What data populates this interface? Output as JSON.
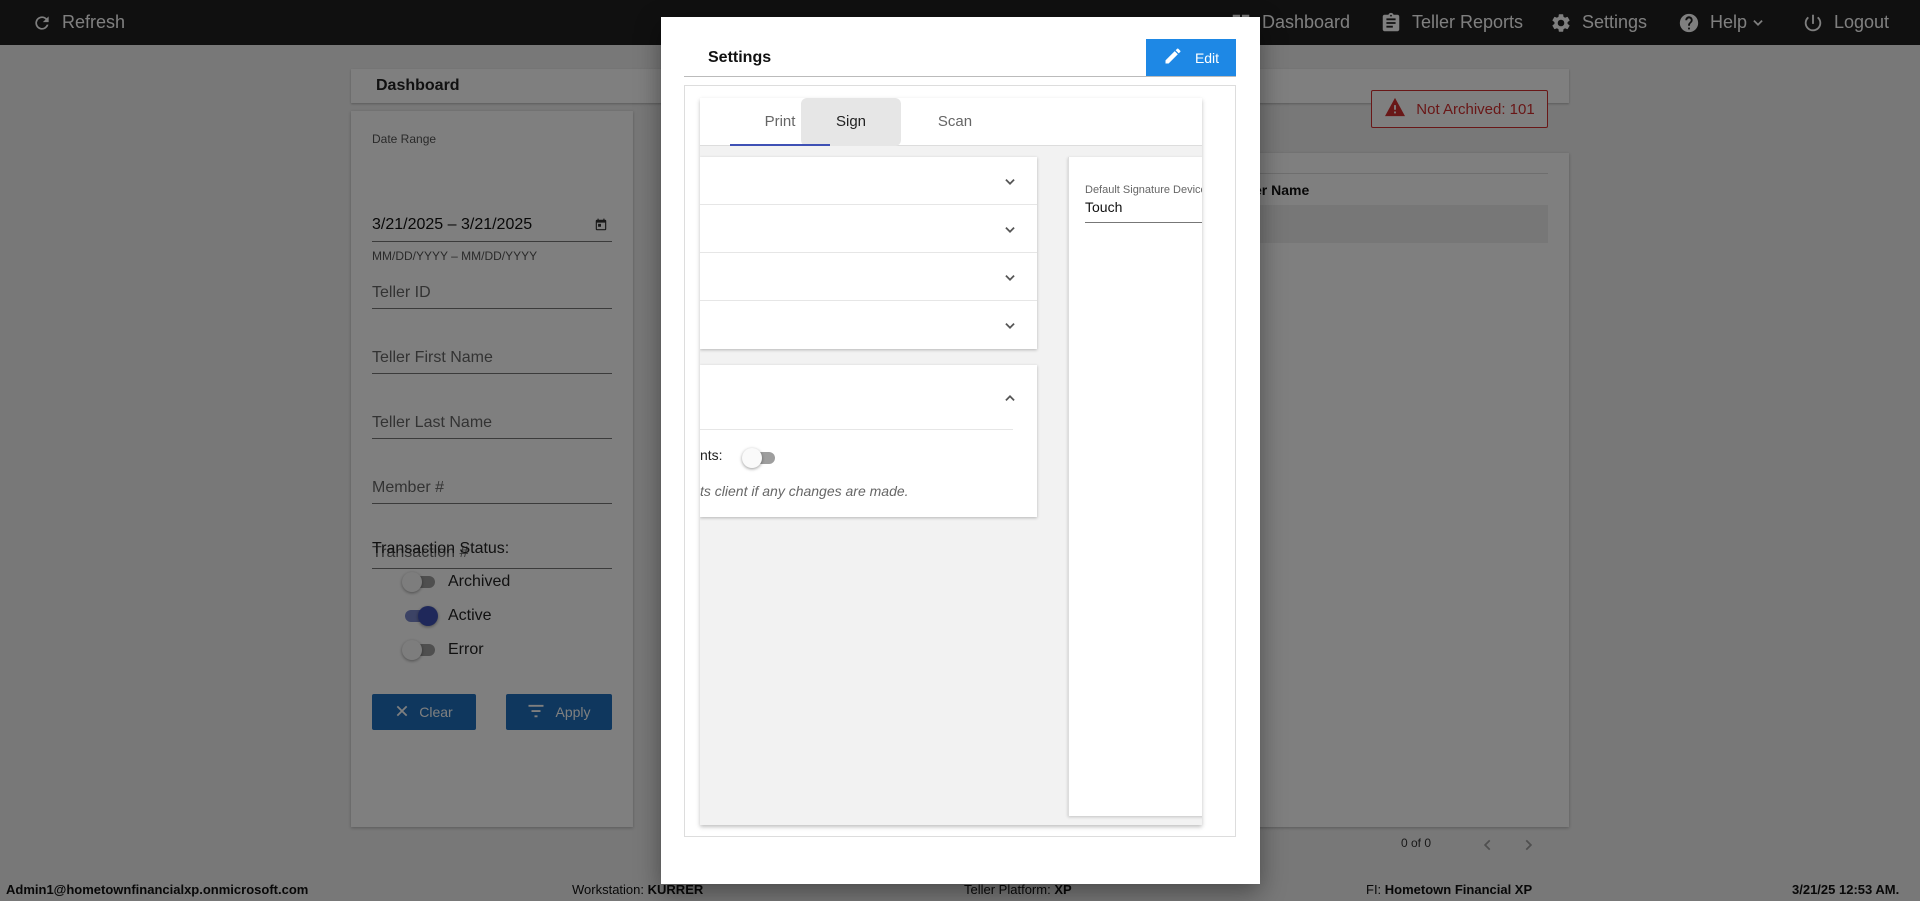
{
  "topnav": {
    "refresh": "Refresh",
    "dashboard": "Dashboard",
    "teller_reports": "Teller Reports",
    "settings": "Settings",
    "help": "Help",
    "logout": "Logout"
  },
  "dashboard": {
    "title": "Dashboard",
    "not_archived": "Not Archived: 101"
  },
  "filters": {
    "date_range_label": "Date Range",
    "date_range_value": "3/21/2025 – 3/21/2025",
    "date_format_hint": "MM/DD/YYYY – MM/DD/YYYY",
    "teller_id": "Teller ID",
    "teller_first_name": "Teller First Name",
    "teller_last_name": "Teller Last Name",
    "member_number": "Member #",
    "transaction_number": "Transaction #",
    "status_title": "Transaction Status:",
    "statuses": [
      {
        "label": "Archived",
        "on": false
      },
      {
        "label": "Active",
        "on": true
      },
      {
        "label": "Error",
        "on": false
      }
    ],
    "clear": "Clear",
    "apply": "Apply"
  },
  "results": {
    "column_partial": "er Name",
    "pager": "0 of 0"
  },
  "footer": {
    "user": "Admin1@hometownfinancialxp.onmicrosoft.com",
    "workstation_label": "Workstation:",
    "workstation": "KURRER",
    "platform_label": "Teller Platform:",
    "platform": "XP",
    "fi_label": "FI:",
    "fi": "Hometown Financial XP",
    "datetime": "3/21/25 12:53 AM."
  },
  "modal": {
    "title": "Settings",
    "edit": "Edit",
    "tabs": [
      "Print",
      "Sign",
      "Scan"
    ],
    "active_tab": "Sign",
    "toggle_label_partial": "nts:",
    "note_partial": "ts client if any changes are made.",
    "default_device_label": "Default Signature Device",
    "default_device_value": "Touch"
  },
  "colors": {
    "nav": "#212121",
    "primary_button": "#1e6fbd",
    "edit_button": "#1e88e5",
    "warning": "#d32f2f",
    "toggle_on": "#3f51b5"
  }
}
